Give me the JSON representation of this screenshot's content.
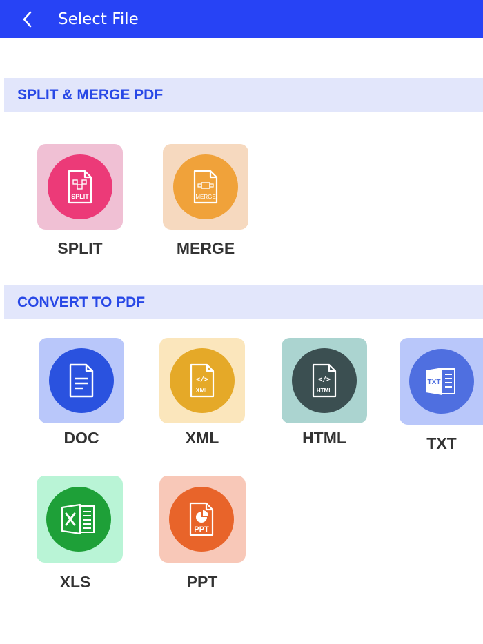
{
  "appbar": {
    "title": "Select File",
    "back_icon": "chevron-left-icon",
    "color": "#2743f5"
  },
  "sections": {
    "split_merge": {
      "title": "SPLIT & MERGE PDF"
    },
    "convert": {
      "title": "CONVERT TO PDF"
    }
  },
  "tiles": {
    "split": {
      "label": "SPLIT",
      "icon": "split-file-icon",
      "icon_text": "SPLIT",
      "bg": "#f0c0d4",
      "circle": "#ec3a78"
    },
    "merge": {
      "label": "MERGE",
      "icon": "merge-file-icon",
      "icon_text": "MERGE",
      "bg": "#f6d9bf",
      "circle": "#f0a23a"
    },
    "doc": {
      "label": "DOC",
      "icon": "doc-file-icon",
      "bg": "#b9c7fa",
      "circle": "#2a52df"
    },
    "xml": {
      "label": "XML",
      "icon": "xml-file-icon",
      "icon_text": "XML",
      "bg": "#fbe6bc",
      "circle": "#e5a928"
    },
    "html": {
      "label": "HTML",
      "icon": "html-file-icon",
      "icon_text": "HTML",
      "bg": "#abd4d0",
      "circle": "#3b4f51"
    },
    "txt": {
      "label": "TXT",
      "icon": "txt-file-icon",
      "icon_text": "TXT",
      "bg": "#b9c7fa",
      "circle": "#4f6fe0"
    },
    "xls": {
      "label": "XLS",
      "icon": "xls-file-icon",
      "bg": "#b9f4d6",
      "circle": "#1ea038"
    },
    "ppt": {
      "label": "PPT",
      "icon": "ppt-file-icon",
      "icon_text": "PPT",
      "bg": "#f8c8b8",
      "circle": "#e8642a"
    }
  }
}
